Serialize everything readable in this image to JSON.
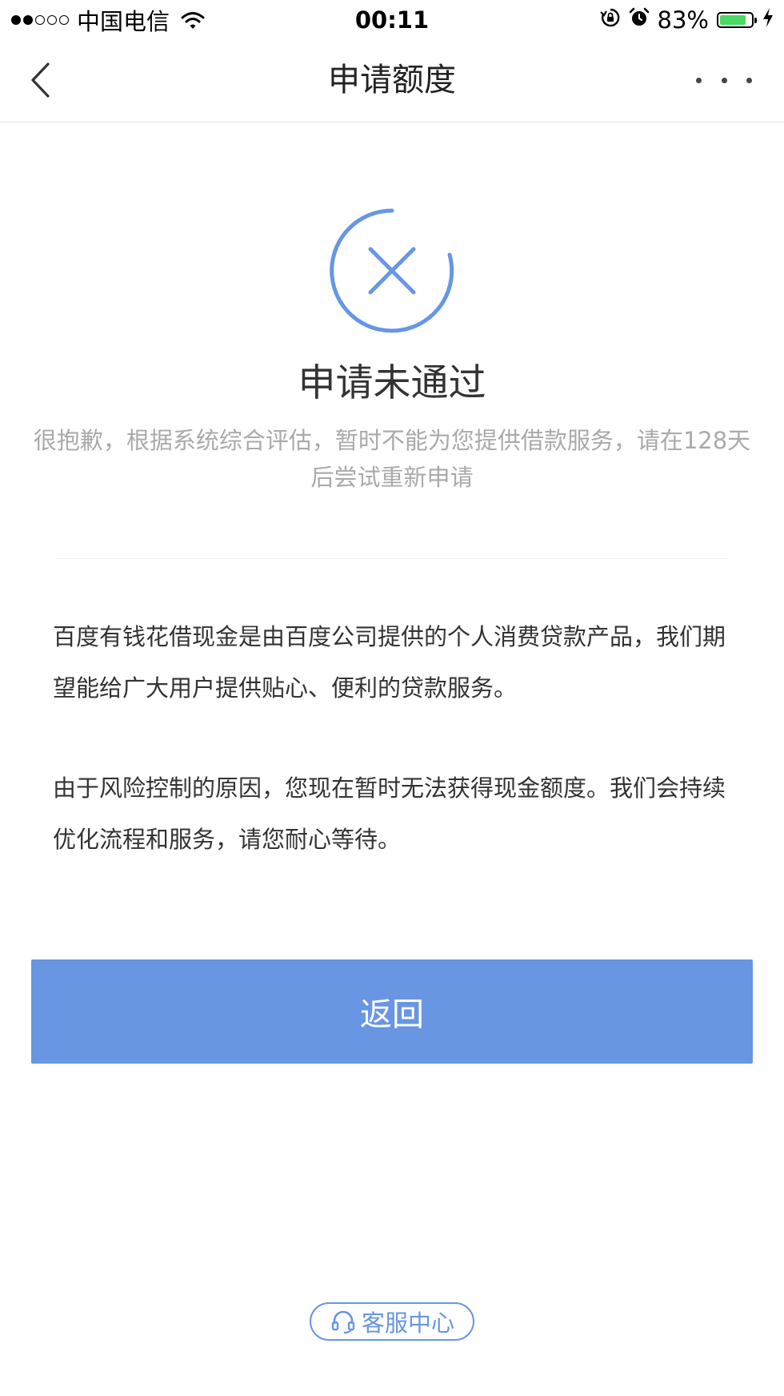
{
  "status_bar": {
    "signal_dots": [
      true,
      true,
      false,
      false,
      false
    ],
    "carrier": "中国电信",
    "time": "00:11",
    "battery_percent_text": "83%",
    "battery_level": 0.83,
    "battery_color": "#4cd964",
    "icons": [
      "wifi-icon",
      "orientation-lock-icon",
      "alarm-icon",
      "battery-icon",
      "charging-icon"
    ]
  },
  "nav": {
    "title": "申请额度",
    "back_icon": "chevron-left-icon",
    "more_icon": "more-dots-icon"
  },
  "result": {
    "icon": "close-circle-icon",
    "accent_color": "#6896e2",
    "title": "申请未通过",
    "description": "很抱歉，根据系统综合评估，暂时不能为您提供借款服务，请在128天后尝试重新申请"
  },
  "info": {
    "paragraph_1": "百度有钱花借现金是由百度公司提供的个人消费贷款产品，我们期望能给广大用户提供贴心、便利的贷款服务。",
    "paragraph_2": "由于风险控制的原因，您现在暂时无法获得现金额度。我们会持续优化流程和服务，请您耐心等待。"
  },
  "actions": {
    "return_label": "返回",
    "service_label": "客服中心",
    "service_icon": "headset-icon"
  }
}
